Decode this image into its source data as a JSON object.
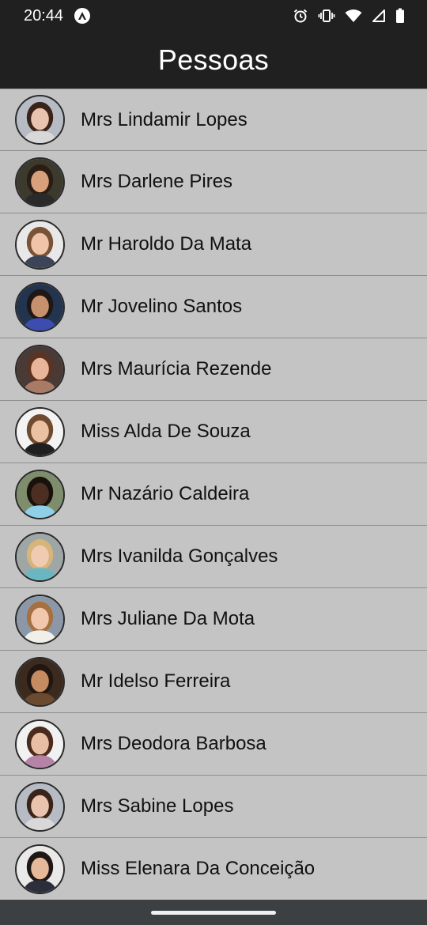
{
  "status_bar": {
    "time": "20:44",
    "icons": [
      "app-notification-icon",
      "alarm-icon",
      "vibrate-icon",
      "wifi-icon",
      "signal-icon",
      "battery-icon"
    ]
  },
  "app_bar": {
    "title": "Pessoas"
  },
  "colors": {
    "bar_background": "#202020",
    "list_background": "#c4c4c4",
    "divider": "#8e8e8e",
    "nav_bar": "#3c4043"
  },
  "people": [
    {
      "name": "Mrs Lindamir Lopes",
      "avatar": {
        "bg": "#b7bcc4",
        "skin": "#e9c3ad",
        "hair": "#3a2319",
        "shirt": "#d8d8d8"
      }
    },
    {
      "name": "Mrs Darlene Pires",
      "avatar": {
        "bg": "#3c3a2d",
        "skin": "#d9a07c",
        "hair": "#2b1c14",
        "shirt": "#2a2a2a"
      }
    },
    {
      "name": "Mr Haroldo Da Mata",
      "avatar": {
        "bg": "#e8e8e8",
        "skin": "#efc4a8",
        "hair": "#7a5236",
        "shirt": "#3b4557"
      }
    },
    {
      "name": "Mr Jovelino Santos",
      "avatar": {
        "bg": "#23344f",
        "skin": "#c8916e",
        "hair": "#1e1713",
        "shirt": "#3c4cb0"
      }
    },
    {
      "name": "Mrs Maurícia Rezende",
      "avatar": {
        "bg": "#4a3a36",
        "skin": "#e8b59a",
        "hair": "#5b3322",
        "shirt": "#a97a66"
      }
    },
    {
      "name": "Miss Alda De Souza",
      "avatar": {
        "bg": "#f3f3f3",
        "skin": "#eac2a3",
        "hair": "#6e4a2f",
        "shirt": "#1f1f1f"
      }
    },
    {
      "name": "Mr Nazário Caldeira",
      "avatar": {
        "bg": "#7e8d6b",
        "skin": "#4c2f22",
        "hair": "#1a110c",
        "shirt": "#8fd0e8"
      }
    },
    {
      "name": "Mrs Ivanilda Gonçalves",
      "avatar": {
        "bg": "#9fa7a6",
        "skin": "#f0cbb2",
        "hair": "#d7b47a",
        "shirt": "#6bb7c1"
      }
    },
    {
      "name": "Mrs Juliane Da Mota",
      "avatar": {
        "bg": "#8c98a8",
        "skin": "#f1c7ad",
        "hair": "#a6713f",
        "shirt": "#f1efe9"
      }
    },
    {
      "name": "Mr Idelso Ferreira",
      "avatar": {
        "bg": "#3b2a1e",
        "skin": "#c58c62",
        "hair": "#221710",
        "shirt": "#6b4a30"
      }
    },
    {
      "name": "Mrs Deodora Barbosa",
      "avatar": {
        "bg": "#f1f1f1",
        "skin": "#e8bfa3",
        "hair": "#4a2a1d",
        "shirt": "#b583a6"
      }
    },
    {
      "name": "Mrs Sabine Lopes",
      "avatar": {
        "bg": "#b7bcc4",
        "skin": "#e9c3ad",
        "hair": "#3a2319",
        "shirt": "#d8d8d8"
      }
    },
    {
      "name": "Miss Elenara Da Conceição",
      "avatar": {
        "bg": "#e9e9e9",
        "skin": "#e6b99b",
        "hair": "#1f1713",
        "shirt": "#2c2f3b"
      }
    }
  ]
}
